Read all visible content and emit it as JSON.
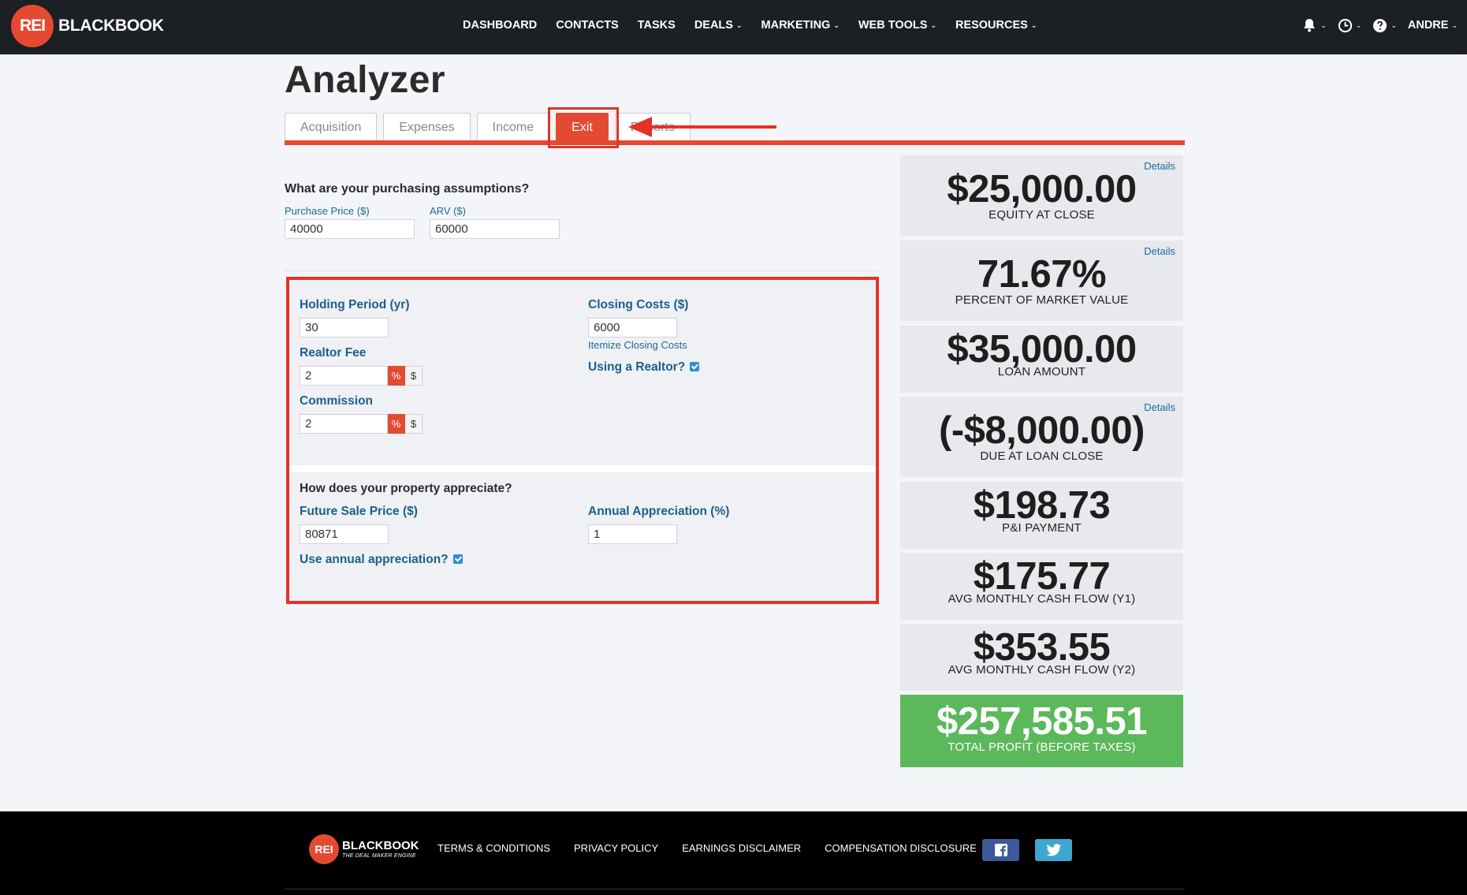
{
  "brand": {
    "badge": "REI",
    "name": "BLACKBOOK"
  },
  "nav": {
    "items": [
      {
        "label": "DASHBOARD",
        "dropdown": false
      },
      {
        "label": "CONTACTS",
        "dropdown": false
      },
      {
        "label": "TASKS",
        "dropdown": false
      },
      {
        "label": "DEALS",
        "dropdown": true
      },
      {
        "label": "MARKETING",
        "dropdown": true
      },
      {
        "label": "WEB TOOLS",
        "dropdown": true
      },
      {
        "label": "RESOURCES",
        "dropdown": true
      }
    ],
    "user": "ANDRE",
    "caret": "⌄",
    "right_icons": [
      "bell-icon",
      "clock-icon",
      "help-icon"
    ]
  },
  "page": {
    "title": "Analyzer"
  },
  "tabs": [
    {
      "label": "Acquisition",
      "active": false
    },
    {
      "label": "Expenses",
      "active": false
    },
    {
      "label": "Income",
      "active": false
    },
    {
      "label": "Exit",
      "active": true
    },
    {
      "label": "Reports",
      "active": false
    }
  ],
  "purchase": {
    "question": "What are your purchasing assumptions?",
    "price_label": "Purchase Price ($)",
    "price_value": "40000",
    "arv_label": "ARV ($)",
    "arv_value": "60000"
  },
  "exit": {
    "holding_label": "Holding Period (yr)",
    "holding_value": "30",
    "closing_label": "Closing Costs ($)",
    "closing_value": "6000",
    "itemize_link": "Itemize Closing Costs",
    "realtor_fee_label": "Realtor Fee",
    "realtor_fee_value": "2",
    "using_realtor_label": "Using a Realtor?",
    "using_realtor_checked": true,
    "commission_label": "Commission",
    "commission_value": "2",
    "percent_symbol": "%",
    "dollar_symbol": "$",
    "appreciation_question": "How does your property appreciate?",
    "future_sale_label": "Future Sale Price ($)",
    "future_sale_value": "80871",
    "annual_appreciation_label": "Annual Appreciation (%)",
    "annual_appreciation_value": "1",
    "use_annual_label": "Use annual appreciation?",
    "use_annual_checked": true
  },
  "stats": {
    "details_label": "Details",
    "items": [
      {
        "value": "$25,000.00",
        "caption": "EQUITY AT CLOSE"
      },
      {
        "value": "71.67%",
        "caption": "PERCENT OF MARKET VALUE"
      },
      {
        "value": "$35,000.00",
        "caption": "LOAN AMOUNT"
      },
      {
        "value": "(-$8,000.00)",
        "caption": "DUE AT LOAN CLOSE"
      },
      {
        "value": "$198.73",
        "caption": "P&I PAYMENT"
      },
      {
        "value": "$175.77",
        "caption": "AVG MONTHLY CASH FLOW (Y1)"
      },
      {
        "value": "$353.55",
        "caption": "AVG MONTHLY CASH FLOW (Y2)"
      },
      {
        "value": "$257,585.51",
        "caption": "TOTAL PROFIT (BEFORE TAXES)"
      }
    ]
  },
  "footer": {
    "badge": "REI",
    "name": "BLACKBOOK",
    "tagline": "THE DEAL MAKER ENGINE",
    "links": [
      "TERMS & CONDITIONS",
      "PRIVACY POLICY",
      "EARNINGS DISCLAIMER",
      "COMPENSATION DISCLOSURE"
    ],
    "social": [
      "facebook-icon",
      "twitter-icon"
    ]
  },
  "colors": {
    "brand_red": "#e44a32",
    "annotation_red": "#e53226",
    "nav_bg": "#1c1f24",
    "link_blue": "#1c6a99",
    "profit_green": "#5bb85b"
  }
}
